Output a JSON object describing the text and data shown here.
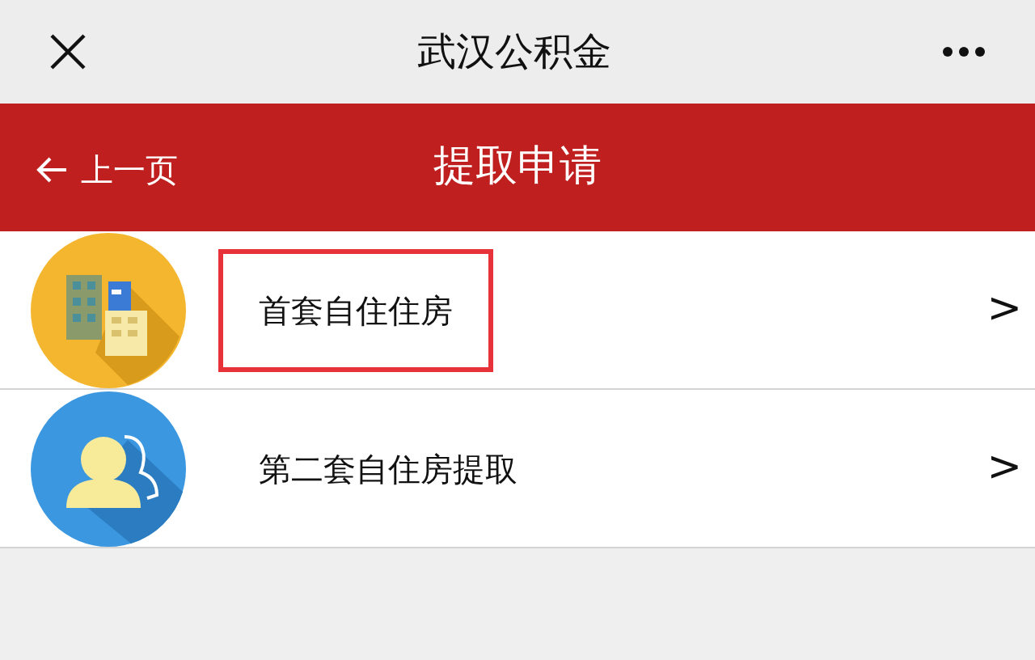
{
  "window": {
    "title": "武汉公积金"
  },
  "header": {
    "back": "上一页",
    "title": "提取申请"
  },
  "items": [
    {
      "kind": "building",
      "label": "首套自住住房",
      "chevron": ">",
      "highlighted": true
    },
    {
      "kind": "person",
      "label": "第二套自住房提取",
      "chevron": ">",
      "highlighted": false
    }
  ]
}
